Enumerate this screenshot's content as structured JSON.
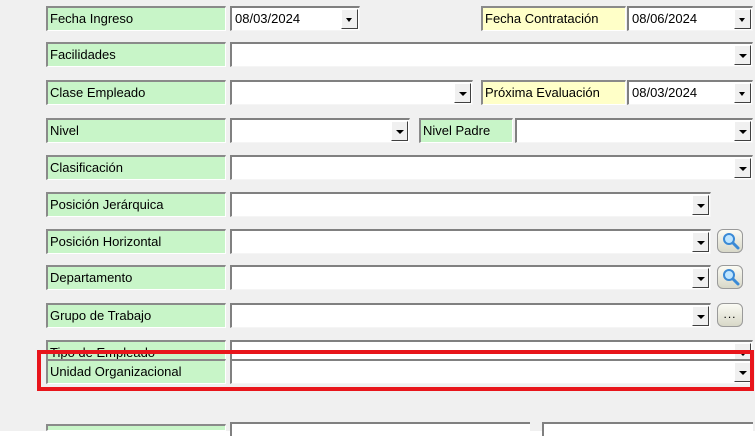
{
  "fields": {
    "fecha_ingreso": {
      "label": "Fecha Ingreso",
      "value": "08/03/2024"
    },
    "fecha_contratacion": {
      "label": "Fecha Contratación",
      "value": "08/06/2024"
    },
    "facilidades": {
      "label": "Facilidades",
      "value": ""
    },
    "clase_empleado": {
      "label": "Clase Empleado",
      "value": ""
    },
    "proxima_evaluacion": {
      "label": "Próxima Evaluación",
      "value": "08/03/2024"
    },
    "nivel": {
      "label": "Nivel",
      "value": ""
    },
    "nivel_padre": {
      "label": "Nivel Padre",
      "value": ""
    },
    "clasificacion": {
      "label": "Clasificación",
      "value": ""
    },
    "posicion_jerarquica": {
      "label": "Posición Jerárquica",
      "value": ""
    },
    "posicion_horizontal": {
      "label": "Posición Horizontal",
      "value": ""
    },
    "departamento": {
      "label": "Departamento",
      "value": ""
    },
    "grupo_trabajo": {
      "label": "Grupo de Trabajo",
      "value": ""
    },
    "tipo_empleado": {
      "label": "Tipo de Empleado",
      "value": ""
    },
    "unidad_organizacional": {
      "label": "Unidad Organizacional",
      "value": ""
    }
  },
  "buttons": {
    "more_label": "..."
  },
  "colors": {
    "label_green": "#c8f5c8",
    "label_yellow": "#ffffc8",
    "highlight_red": "#e8151b"
  },
  "icons": {
    "search": "magnifier-icon",
    "dropdown": "chevron-down-icon"
  }
}
